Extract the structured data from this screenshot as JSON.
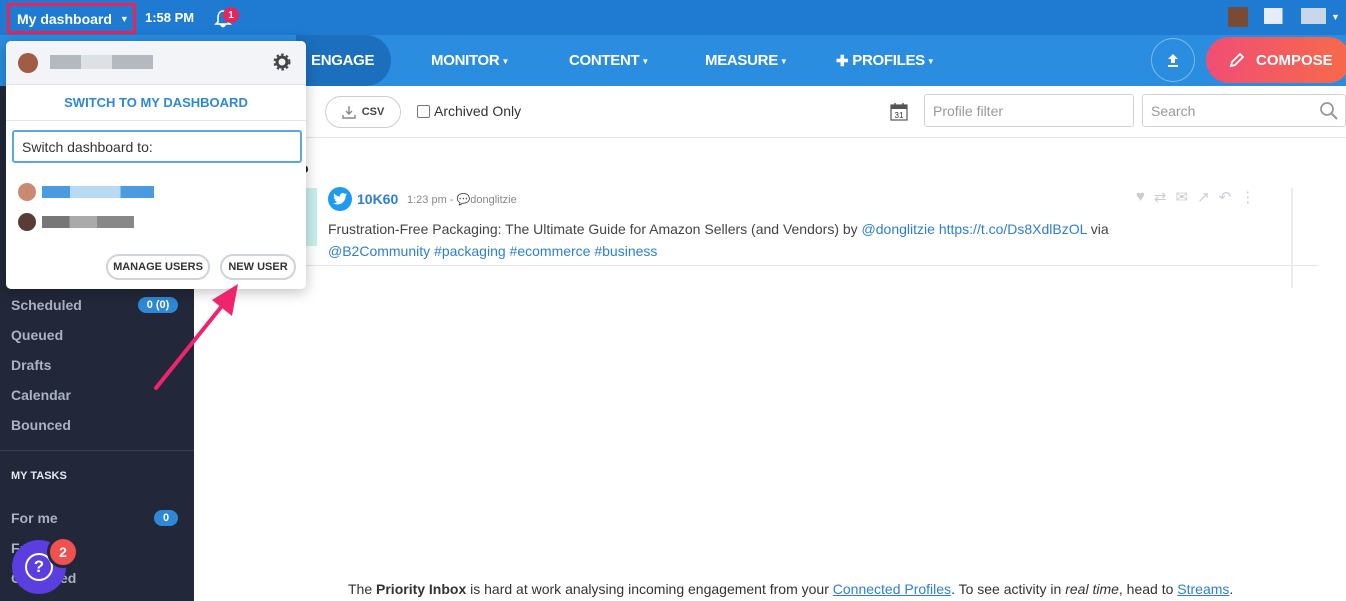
{
  "topbar": {
    "dashboard_label": "My dashboard",
    "time": "1:58 PM",
    "notification_count": "1",
    "icons": [
      "bell-icon",
      "chevron-down-icon"
    ]
  },
  "nav": {
    "items": [
      {
        "label": "ENGAGE"
      },
      {
        "label": "MONITOR"
      },
      {
        "label": "CONTENT"
      },
      {
        "label": "MEASURE"
      },
      {
        "label": "PROFILES"
      }
    ],
    "compose_label": "COMPOSE"
  },
  "dropdown": {
    "switch_my_dashboard": "SWITCH TO MY DASHBOARD",
    "switch_placeholder": "Switch dashboard to:",
    "manage_users": "MANAGE USERS",
    "new_user": "NEW USER"
  },
  "toolbar": {
    "csv_label": "CSV",
    "archived_label": "Archived Only",
    "calendar_day": "31",
    "profile_filter_placeholder": "Profile filter",
    "search_placeholder": "Search"
  },
  "sidebar": {
    "items": [
      {
        "label": "Scheduled",
        "badge": "0 (0)"
      },
      {
        "label": "Queued"
      },
      {
        "label": "Drafts"
      },
      {
        "label": "Calendar"
      },
      {
        "label": "Bounced"
      }
    ],
    "tasks_heading": "MY TASKS",
    "tasks": [
      {
        "label": "For me",
        "badge": "0"
      },
      {
        "label": "Fo"
      },
      {
        "label": "C          ed"
      }
    ],
    "help_badge": "2"
  },
  "content": {
    "section_fragment": "o",
    "post": {
      "user": "10K60",
      "time": "1:23 pm -",
      "reply_to": "donglitzie",
      "text": "Frustration-Free Packaging: The Ultimate Guide for Amazon Sellers (and Vendors) by ",
      "mention1": "@donglitzie",
      "link": "https://t.co/Ds8XdlBzOL",
      "via": " via",
      "mention2": "@B2Community",
      "tags": [
        "#packaging",
        "#ecommerce",
        "#business"
      ]
    },
    "priority": {
      "p1": "The ",
      "bold": "Priority Inbox",
      "p2": " is hard at work analysing incoming engagement from your ",
      "link1": "Connected Profiles",
      "p3": ". To see activity in ",
      "italic": "real time",
      "p4": ", head to ",
      "link2": "Streams",
      "p5": "."
    }
  },
  "colors": {
    "topbar": "#1f7bd1",
    "navbar": "#2a8de0",
    "sidebar": "#22283a",
    "accent_pink": "#e8245a",
    "link_blue": "#2d7fd2"
  }
}
